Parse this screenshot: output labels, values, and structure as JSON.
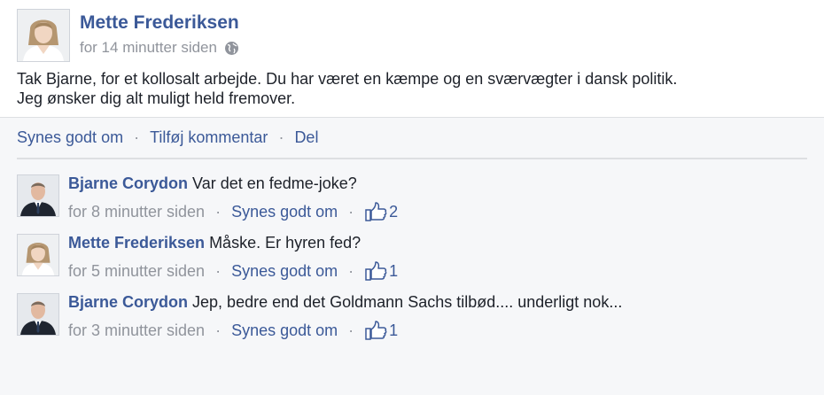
{
  "post": {
    "author": "Mette Frederiksen",
    "time": "for 14 minutter siden",
    "audience_icon": "globe-icon",
    "text_line1": "Tak Bjarne, for et kollosalt arbejde. Du har været en kæmpe og en sværvægter i dansk politik.",
    "text_line2": "Jeg ønsker dig alt muligt held fremover.",
    "actions": {
      "like": "Synes godt om",
      "comment": "Tilføj kommentar",
      "share": "Del",
      "separator": "·"
    }
  },
  "comments": [
    {
      "author": "Bjarne Corydon",
      "text": "Var det en fedme-joke?",
      "time": "for 8 minutter siden",
      "like_label": "Synes godt om",
      "likes": "2"
    },
    {
      "author": "Mette Frederiksen",
      "text": "Måske. Er hyren fed?",
      "time": "for 5 minutter siden",
      "like_label": "Synes godt om",
      "likes": "1"
    },
    {
      "author": "Bjarne Corydon",
      "text": "Jep, bedre end det Goldmann Sachs tilbød.... underligt nok...",
      "time": "for 3 minutter siden",
      "like_label": "Synes godt om",
      "likes": "1"
    }
  ],
  "colors": {
    "link": "#3b5998",
    "meta": "#90949c",
    "text": "#1d2129",
    "background": "#f6f7f9"
  }
}
